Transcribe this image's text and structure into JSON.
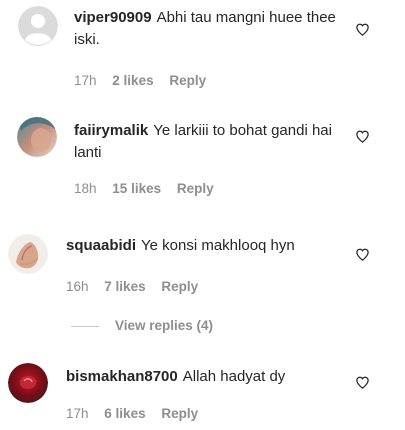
{
  "comments": [
    {
      "username": "viper90909",
      "text": "Abhi tau mangni huee thee iski.",
      "time": "17h",
      "likes": "2 likes",
      "reply": "Reply"
    },
    {
      "username": "faiirymalik",
      "text": "Ye larkiii to bohat gandi hai lanti",
      "time": "18h",
      "likes": "15 likes",
      "reply": "Reply"
    },
    {
      "username": "squaabidi",
      "text": "Ye konsi makhlooq hyn",
      "time": "16h",
      "likes": "7 likes",
      "reply": "Reply",
      "view_replies": "View replies (4)"
    },
    {
      "username": "bismakhan8700",
      "text": "Allah hadyat dy",
      "time": "17h",
      "likes": "6 likes",
      "reply": "Reply"
    }
  ],
  "colors": {
    "muted": "#8e8e8e",
    "text": "#262626"
  },
  "icons": {
    "like": "heart-outline-icon"
  }
}
